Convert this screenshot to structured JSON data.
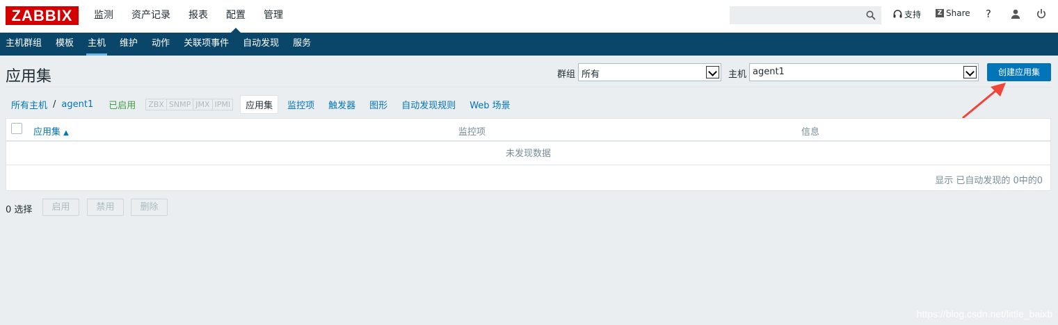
{
  "brand": {
    "logo_text": "ZABBIX",
    "logo_color": "#d40000"
  },
  "main_menu": {
    "items": [
      {
        "label": "监测"
      },
      {
        "label": "资产记录"
      },
      {
        "label": "报表"
      },
      {
        "label": "配置",
        "active": true
      },
      {
        "label": "管理"
      }
    ]
  },
  "header_tools": {
    "search_placeholder": "",
    "support_label": "支持",
    "share_label": "Share",
    "share_badge": "Z",
    "help_label": "?"
  },
  "sub_menu": {
    "items": [
      {
        "label": "主机群组"
      },
      {
        "label": "模板"
      },
      {
        "label": "主机",
        "active": true
      },
      {
        "label": "维护"
      },
      {
        "label": "动作"
      },
      {
        "label": "关联项事件"
      },
      {
        "label": "自动发现"
      },
      {
        "label": "服务"
      }
    ]
  },
  "page": {
    "title": "应用集",
    "filter_group_label": "群组",
    "filter_group_value": "所有",
    "filter_host_label": "主机",
    "filter_host_value": "agent1",
    "create_button": "创建应用集"
  },
  "host_nav": {
    "all_hosts": "所有主机",
    "separator": "/",
    "host": "agent1",
    "status": "已启用",
    "protocols": [
      "ZBX",
      "SNMP",
      "JMX",
      "IPMI"
    ],
    "tabs": [
      "应用集",
      "监控项",
      "触发器",
      "图形",
      "自动发现规则",
      "Web 场景"
    ],
    "current_tab": "应用集"
  },
  "table": {
    "columns": [
      "应用集",
      "监控项",
      "信息"
    ],
    "sort_indicator": "▲",
    "empty_message": "未发现数据",
    "paging_text": "显示 已自动发现的 0中的0"
  },
  "actions": {
    "selected_count": "0 选择",
    "enable": "启用",
    "disable": "禁用",
    "delete": "删除"
  },
  "watermark": "https://blog.csdn.net/little_baixb",
  "colors": {
    "subnav_bg": "#0a466a",
    "primary_button": "#0275b8",
    "link": "#0275b8",
    "enabled_status": "#429e47",
    "annotation_arrow": "#f0453a"
  }
}
